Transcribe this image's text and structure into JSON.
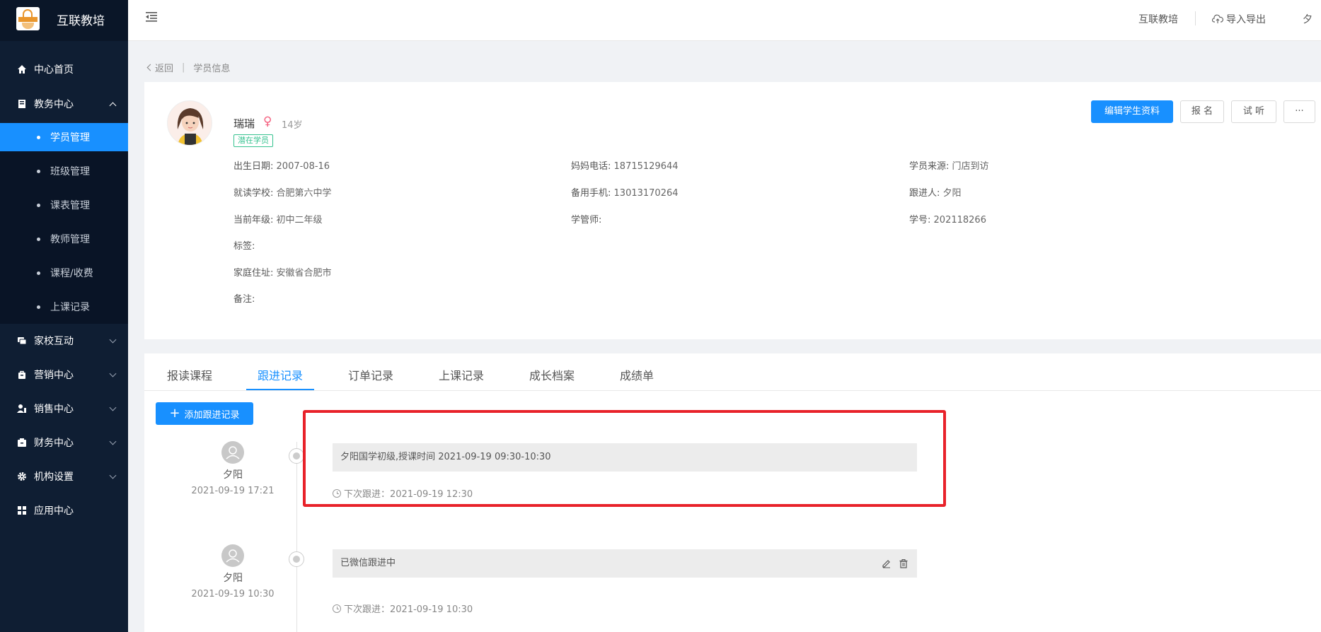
{
  "app": {
    "name": "互联教培"
  },
  "header": {
    "org": "互联教培",
    "import_export": "导入导出",
    "user_initial": "夕"
  },
  "sidebar": {
    "items": [
      {
        "label": "中心首页",
        "icon": "home-icon"
      },
      {
        "label": "教务中心",
        "icon": "book-icon",
        "expanded": true
      },
      {
        "label": "家校互动",
        "icon": "chat-icon"
      },
      {
        "label": "营销中心",
        "icon": "bag-icon"
      },
      {
        "label": "销售中心",
        "icon": "sales-icon"
      },
      {
        "label": "财务中心",
        "icon": "wallet-icon"
      },
      {
        "label": "机构设置",
        "icon": "gear-icon"
      },
      {
        "label": "应用中心",
        "icon": "grid-icon"
      }
    ],
    "subitems": [
      {
        "label": "学员管理",
        "active": true
      },
      {
        "label": "班级管理"
      },
      {
        "label": "课表管理"
      },
      {
        "label": "教师管理"
      },
      {
        "label": "课程/收费"
      },
      {
        "label": "上课记录"
      }
    ]
  },
  "breadcrumb": {
    "back": "返回",
    "current": "学员信息"
  },
  "student": {
    "name": "瑞瑞",
    "gender_symbol": "♀",
    "age": "14岁",
    "status": "潜在学员",
    "fields": {
      "birth_label": "出生日期:",
      "birth": "2007-08-16",
      "school_label": "就读学校:",
      "school": "合肥第六中学",
      "grade_label": "当前年级:",
      "grade": "初中二年级",
      "tags_label": "标签:",
      "address_label": "家庭住址:",
      "address": "安徽省合肥市",
      "note_label": "备注:",
      "mom_phone_label": "妈妈电话:",
      "mom_phone": "18715129644",
      "backup_phone_label": "备用手机:",
      "backup_phone": "13013170264",
      "manager_label": "学管师:",
      "source_label": "学员来源:",
      "source": "门店到访",
      "follower_label": "跟进人:",
      "follower": "夕阳",
      "student_no_label": "学号:",
      "student_no": "202118266"
    }
  },
  "actions": {
    "edit": "编辑学生资料",
    "enroll": "报 名",
    "trial": "试 听",
    "more": "···"
  },
  "tabs": [
    "报读课程",
    "跟进记录",
    "订单记录",
    "上课记录",
    "成长档案",
    "成绩单"
  ],
  "active_tab": "跟进记录",
  "add_record": "添加跟进记录",
  "records": [
    {
      "user": "夕阳",
      "time": "2021-09-19 17:21",
      "content": "夕阳国学初级,授课时间 2021-09-19 09:30-10:30",
      "next": "下次跟进：2021-09-19 12:30"
    },
    {
      "user": "夕阳",
      "time": "2021-09-19 10:30",
      "content": "已微信跟进中",
      "next": "下次跟进：2021-09-19 10:30"
    }
  ],
  "colors": {
    "accent": "#1890ff",
    "sidebar": "#0f1e33",
    "highlight": "#e8222a",
    "badge": "#35c28f"
  }
}
